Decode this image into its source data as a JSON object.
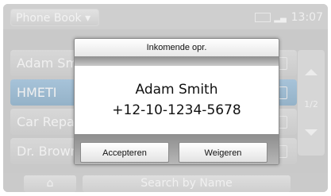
{
  "topbar": {
    "phonebook_label": "Phone Book ▾",
    "signal": "▂▄",
    "time": "13:07"
  },
  "contacts": [
    {
      "name": "Adam Smith"
    },
    {
      "name": "HMETI"
    },
    {
      "name": "Car Repair"
    },
    {
      "name": "Dr. Brown"
    }
  ],
  "scroll": {
    "page": "1/2"
  },
  "bottombar": {
    "home_icon": "home-icon",
    "home_glyph": "⌂",
    "search_label": "Search by Name"
  },
  "dialog": {
    "title": "Inkomende opr.",
    "caller_name": "Adam Smith",
    "caller_number": "+12-10-1234-5678",
    "accept_label": "Accepteren",
    "decline_label": "Weigeren"
  }
}
